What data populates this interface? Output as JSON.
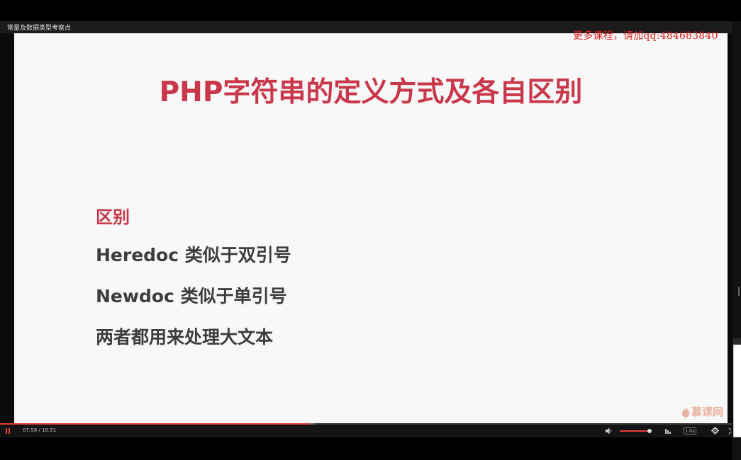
{
  "player": {
    "video_title": "常量及数据类型考察点",
    "watermark": "更多课程，请加qq:484683840",
    "current_time": "07:58",
    "separator": "/",
    "duration": "18:51",
    "time_display": "07:58 / 18:51",
    "progress_fraction": 0.423,
    "buffered_fraction": 0.43,
    "volume_fraction": 0.95,
    "speed_label": "1.0x",
    "accent_color": "#e53935"
  },
  "slide": {
    "title": "PHP字符串的定义方式及各自区别",
    "section_label": "区别",
    "points": [
      "Heredoc 类似于双引号",
      "Newdoc 类似于单引号",
      "两者都用来处理大文本"
    ],
    "logo_text": "慕课网",
    "title_color": "#c9384a",
    "body_color": "#3d3d3d"
  },
  "icons": {
    "play_pause": "pause-icon",
    "volume": "volume-icon",
    "quality": "quality-bars-icon",
    "settings": "gear-icon",
    "fullscreen": "fullscreen-icon",
    "logo": "flame-logo-icon"
  }
}
